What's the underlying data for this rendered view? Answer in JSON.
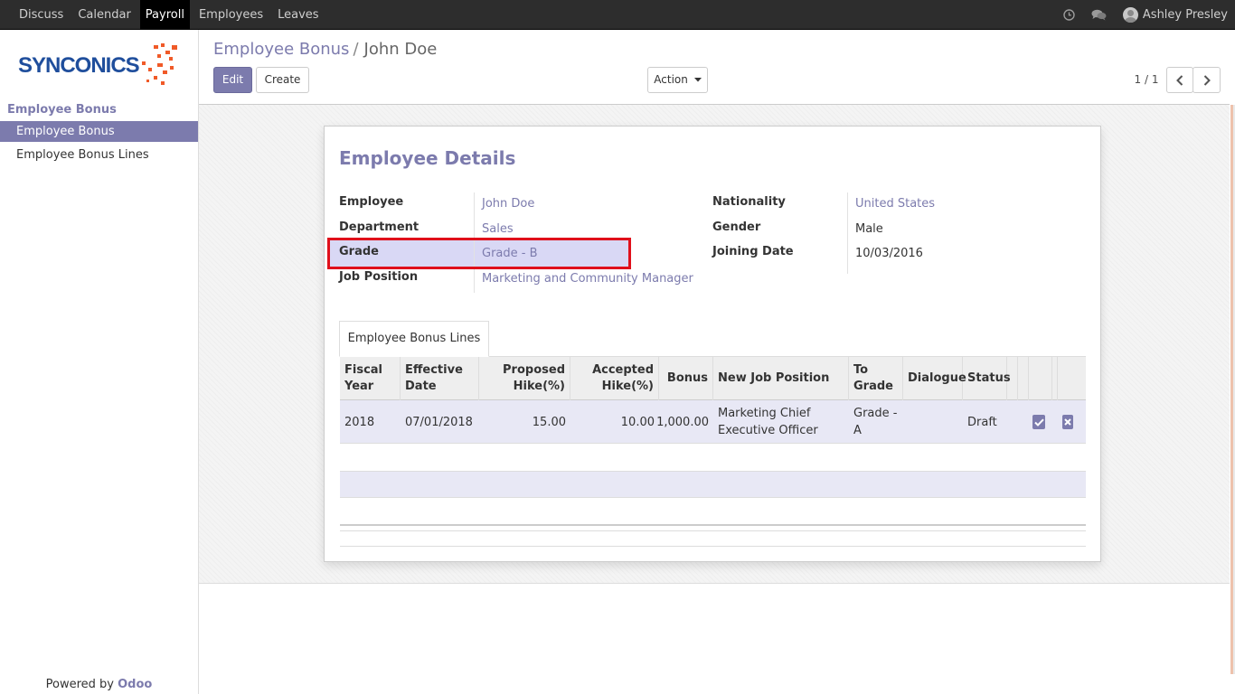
{
  "navbar": {
    "menu": [
      "Discuss",
      "Calendar",
      "Payroll",
      "Employees",
      "Leaves"
    ],
    "active": "Payroll",
    "user": "Ashley Presley",
    "icons": [
      "clock-icon",
      "chat-icon",
      "avatar"
    ]
  },
  "sidebar": {
    "logo": "SYNCONICS",
    "category": "Employee Bonus",
    "items": [
      {
        "label": "Employee Bonus",
        "active": true
      },
      {
        "label": "Employee Bonus Lines",
        "active": false
      }
    ],
    "powered_by": "Powered by",
    "brand": "Odoo"
  },
  "control": {
    "breadcrumb": {
      "parent": "Employee Bonus",
      "separator": "/",
      "current": "John Doe"
    },
    "edit_label": "Edit",
    "create_label": "Create",
    "action_label": "Action",
    "pager": "1 / 1"
  },
  "form": {
    "title": "Employee Details",
    "left": [
      {
        "label": "Employee",
        "value": "John Doe"
      },
      {
        "label": "Department",
        "value": "Sales"
      },
      {
        "label": "Grade",
        "value": "Grade - B"
      },
      {
        "label": "Job Position",
        "value": "Marketing and Community Manager"
      }
    ],
    "right": [
      {
        "label": "Nationality",
        "value": "United States"
      },
      {
        "label": "Gender",
        "value": "Male"
      },
      {
        "label": "Joining Date",
        "value": "10/03/2016"
      }
    ],
    "tab_label": "Employee Bonus Lines",
    "columns": [
      {
        "line1": "Fiscal",
        "line2": "Year"
      },
      {
        "line1": "Effective",
        "line2": "Date"
      },
      {
        "line1": "Proposed",
        "line2": "Hike(%)"
      },
      {
        "line1": "Accepted",
        "line2": "Hike(%)"
      },
      {
        "line1": "Bonus",
        "line2": ""
      },
      {
        "line1": "New Job Position",
        "line2": ""
      },
      {
        "line1": "To",
        "line2": "Grade"
      },
      {
        "line1": "Dialogue",
        "line2": ""
      },
      {
        "line1": "Status",
        "line2": ""
      }
    ],
    "rows": [
      {
        "fiscal_year": "2018",
        "effective_date": "07/01/2018",
        "proposed_hike": "15.00",
        "accepted_hike": "10.00",
        "bonus": "1,000.00",
        "new_job_line1": "Marketing Chief",
        "new_job_line2": "Executive Officer",
        "to_grade_line1": "Grade -",
        "to_grade_line2": "A",
        "dialogue": "",
        "status": "Draft"
      }
    ]
  },
  "colors": {
    "accent": "#7c7bad",
    "highlight_box": "#e0101b",
    "navbar": "#2d2d2d"
  }
}
